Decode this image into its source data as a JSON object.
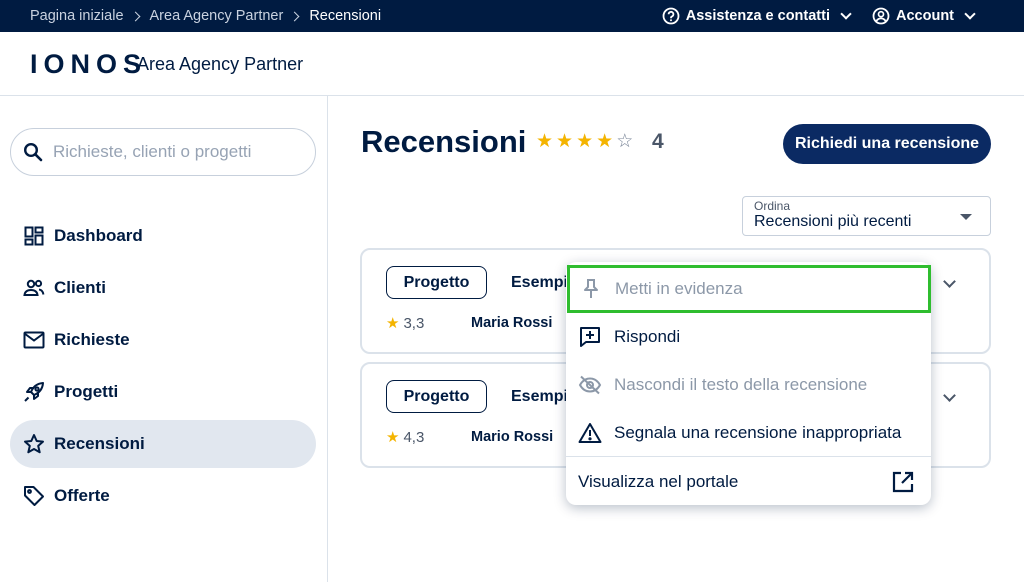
{
  "breadcrumb": [
    "Pagina iniziale",
    "Area Agency Partner",
    "Recensioni"
  ],
  "topnav": {
    "help": "Assistenza e contatti",
    "account": "Account"
  },
  "header": {
    "logo": "IONOS",
    "title": "Area Agency Partner"
  },
  "search": {
    "placeholder": "Richieste, clienti o progetti"
  },
  "sidebar": {
    "items": [
      {
        "label": "Dashboard",
        "icon": "dashboard-icon"
      },
      {
        "label": "Clienti",
        "icon": "people-icon"
      },
      {
        "label": "Richieste",
        "icon": "mail-icon"
      },
      {
        "label": "Progetti",
        "icon": "rocket-icon"
      },
      {
        "label": "Recensioni",
        "icon": "star-icon",
        "active": true
      },
      {
        "label": "Offerte",
        "icon": "tag-icon"
      }
    ]
  },
  "main": {
    "title": "Recensioni",
    "rating": {
      "stars": 4,
      "max": 5,
      "value": "4"
    },
    "request_button": "Richiedi una recensione",
    "sort": {
      "label": "Ordina",
      "value": "Recensioni più recenti"
    },
    "reviews": [
      {
        "badge": "Progetto",
        "title": "Esempi",
        "rating": "3,3",
        "author": "Maria Rossi"
      },
      {
        "badge": "Progetto",
        "title": "Esempi",
        "rating": "4,3",
        "author": "Mario Rossi"
      }
    ]
  },
  "menu": {
    "items": [
      {
        "label": "Metti in evidenza",
        "icon": "pin-icon",
        "disabled": true,
        "highlighted": true
      },
      {
        "label": "Rispondi",
        "icon": "reply-icon",
        "disabled": false
      },
      {
        "label": "Nascondi il testo della recensione",
        "icon": "eye-off-icon",
        "disabled": true
      },
      {
        "label": "Segnala una recensione inappropriata",
        "icon": "warning-icon",
        "disabled": false
      }
    ],
    "portal": {
      "label": "Visualizza nel portale",
      "icon": "external-link-icon"
    }
  },
  "colors": {
    "brand": "#001b41",
    "button": "#0b2a63",
    "star": "#f4b400",
    "highlight": "#2fbd2f"
  }
}
